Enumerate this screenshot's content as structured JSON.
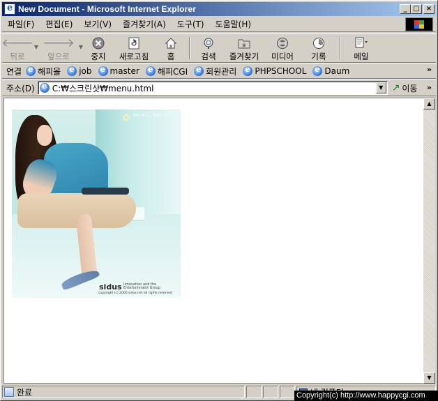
{
  "window": {
    "title": "New Document - Microsoft Internet Explorer"
  },
  "caption_buttons": {
    "minimize": "_",
    "maximize": "□",
    "close": "×"
  },
  "menu": [
    "파일(F)",
    "편집(E)",
    "보기(V)",
    "즐겨찾기(A)",
    "도구(T)",
    "도움말(H)"
  ],
  "toolbar": {
    "back": "뒤로",
    "forward": "앞으로",
    "stop": "중지",
    "refresh": "새로고침",
    "home": "홈",
    "search": "검색",
    "favorites": "즐겨찾기",
    "media": "미디어",
    "history": "기록",
    "mail": "메일"
  },
  "links": {
    "label": "연결",
    "items": [
      "해피몰",
      "job",
      "master",
      "해피CGI",
      "회원관리",
      "PHPSCHOOL",
      "Daum"
    ],
    "more": "»"
  },
  "address": {
    "label": "주소(D)",
    "value": "C:₩스크린샷₩menu.html",
    "go": "이동"
  },
  "photo": {
    "brand": "sidus",
    "tag": "Gerell Gerill",
    "sub": "Innovation and the Entertainment Group",
    "copyright": "copyright (c) 2000 sidus.net all rights reserved"
  },
  "status": {
    "text": "완료",
    "zone": "내 컴퓨터"
  },
  "watermark": "Copyright(c) http://www.happycgi.com"
}
